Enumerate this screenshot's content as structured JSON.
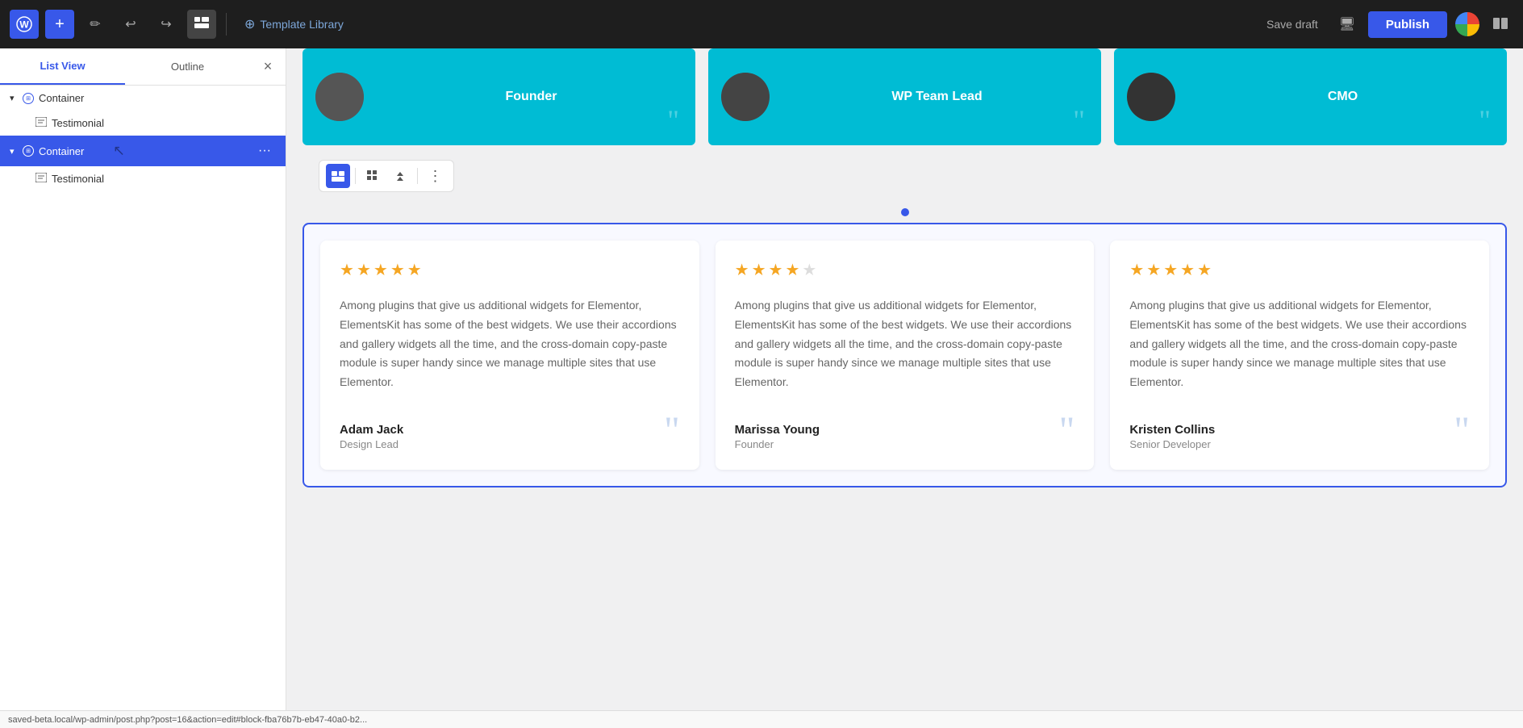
{
  "topbar": {
    "wp_logo": "W",
    "add_label": "+",
    "pencil_label": "✏",
    "undo_label": "↩",
    "redo_label": "↪",
    "hamburger_label": "☰",
    "template_library_label": "Template Library",
    "save_draft_label": "Save draft",
    "publish_label": "Publish"
  },
  "sidebar": {
    "tab_list_view": "List View",
    "tab_outline": "Outline",
    "close_label": "×",
    "tree": [
      {
        "id": "container-1",
        "label": "Container",
        "type": "container",
        "expanded": true,
        "selected": false,
        "children": [
          {
            "id": "testimonial-1",
            "label": "Testimonial",
            "type": "testimonial",
            "selected": false
          }
        ]
      },
      {
        "id": "container-2",
        "label": "Container",
        "type": "container",
        "expanded": true,
        "selected": true,
        "children": [
          {
            "id": "testimonial-2",
            "label": "Testimonial",
            "type": "testimonial",
            "selected": false
          }
        ]
      }
    ]
  },
  "top_cards": [
    {
      "title": "Founder"
    },
    {
      "title": "WP Team Lead"
    },
    {
      "title": "CMO"
    }
  ],
  "pagination_dot": true,
  "testimonials": [
    {
      "stars": 5,
      "text": "Among plugins that give us additional widgets for Elementor, ElementsKit has some of the best widgets. We use their accordions and gallery widgets all the time, and the cross-domain copy-paste module is super handy since we manage multiple sites that use Elementor.",
      "author": "Adam Jack",
      "role": "Design Lead"
    },
    {
      "stars": 4,
      "text": "Among plugins that give us additional widgets for Elementor, ElementsKit has some of the best widgets. We use their accordions and gallery widgets all the time, and the cross-domain copy-paste module is super handy since we manage multiple sites that use Elementor.",
      "author": "Marissa Young",
      "role": "Founder"
    },
    {
      "stars": 5,
      "text": "Among plugins that give us additional widgets for Elementor, ElementsKit has some of the best widgets. We use their accordions and gallery widgets all the time, and the cross-domain copy-paste module is super handy since we manage multiple sites that use Elementor.",
      "author": "Kristen Collins",
      "role": "Senior Developer"
    }
  ],
  "status_bar_text": "saved-beta.local/wp-admin/post.php?post=16&action=edit#block-fba76b7b-eb47-40a0-b2..."
}
